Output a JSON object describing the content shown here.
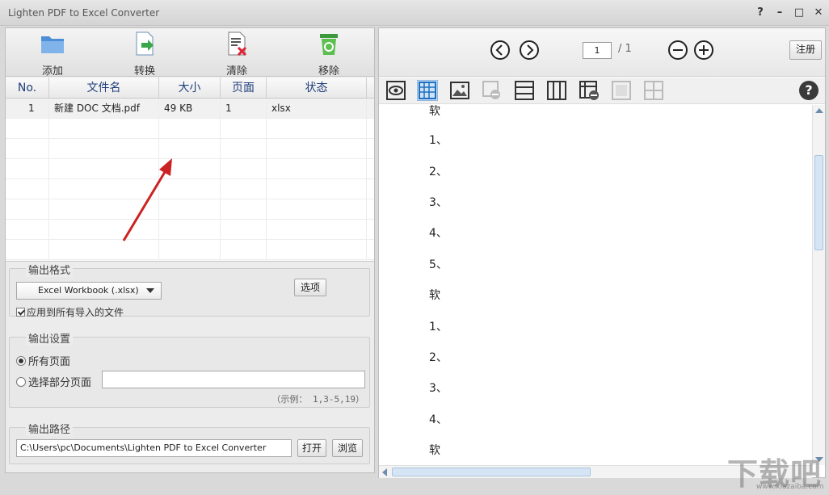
{
  "window": {
    "title": "Lighten PDF to Excel Converter",
    "help_glyph": "?",
    "minimize_glyph": "–",
    "maximize_glyph": "□",
    "close_glyph": "✕"
  },
  "toolbar": {
    "add_label": "添加",
    "convert_label": "转换",
    "clear_label": "清除",
    "remove_label": "移除"
  },
  "file_table": {
    "columns": [
      "No.",
      "文件名",
      "大小",
      "页面",
      "状态"
    ],
    "rows": [
      {
        "no": "1",
        "name": "新建 DOC 文档.pdf",
        "size": "49 KB",
        "pages": "1",
        "status": "xlsx"
      }
    ]
  },
  "output_format": {
    "title": "输出格式",
    "selected": "Excel Workbook (.xlsx)",
    "options_button": "选项",
    "apply_all_label": "应用到所有导入的文件"
  },
  "output_settings": {
    "title": "输出设置",
    "all_pages_label": "所有页面",
    "some_pages_label": "选择部分页面",
    "range_value": "",
    "example_hint": "（示例： 1,3-5,19）"
  },
  "output_path": {
    "title": "输出路径",
    "value": "C:\\Users\\pc\\Documents\\Lighten PDF to Excel Converter",
    "open_button": "打开",
    "browse_button": "浏览"
  },
  "viewer": {
    "page_current": "1",
    "page_total": "/ 1",
    "register_button": "注册",
    "help_glyph": "?",
    "lines": [
      "软",
      "1、",
      "2、",
      "3、",
      "4、",
      "5、",
      "软",
      "1、",
      "2、",
      "3、",
      "4、",
      "软"
    ]
  },
  "watermark": {
    "text": "下载吧",
    "url": "www.xiazaiba.com"
  },
  "colors": {
    "header_text": "#1f3f7a",
    "arrow": "#cc2222",
    "active_tool": "#cfe3f7"
  }
}
